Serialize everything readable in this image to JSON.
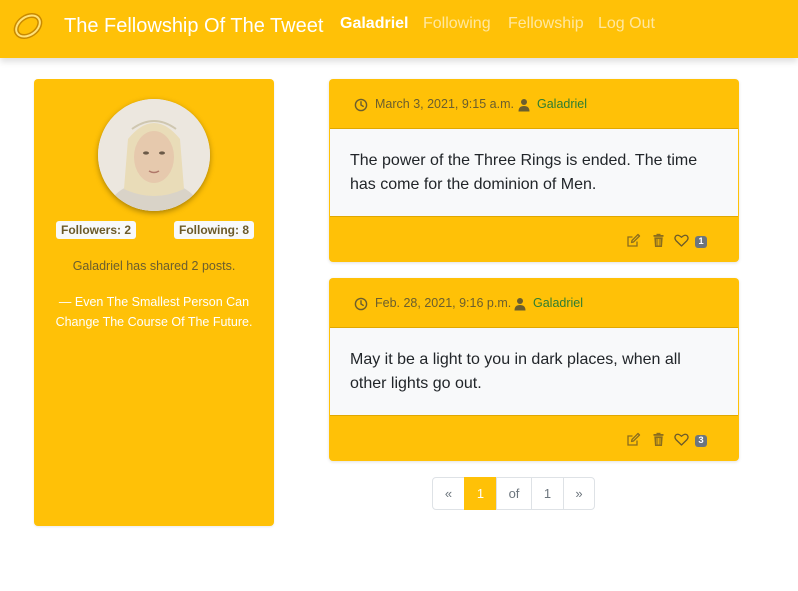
{
  "navbar": {
    "brand_title": "The Fellowship Of The Tweet",
    "links": [
      {
        "label": "Galadriel",
        "active": true
      },
      {
        "label": "Following",
        "active": false
      },
      {
        "label": "Fellowship",
        "active": false
      },
      {
        "label": "Log Out",
        "active": false
      }
    ]
  },
  "profile": {
    "followers_label": "Followers: 2",
    "following_label": "Following: 8",
    "shared_text": "Galadriel has shared 2 posts.",
    "quote": "— Even The Smallest Person Can Change The Course Of The Future."
  },
  "posts": [
    {
      "date": "March 3, 2021, 9:15 a.m.",
      "author": "Galadriel",
      "text": "The power of the Three Rings is ended. The time has come for the dominion of Men.",
      "likes": "1"
    },
    {
      "date": "Feb. 28, 2021, 9:16 p.m.",
      "author": "Galadriel",
      "text": "May it be a light to you in dark places, when all other lights go out.",
      "likes": "3"
    }
  ],
  "pagination": {
    "prev": "«",
    "current": "1",
    "of": "of",
    "total": "1",
    "next": "»"
  },
  "colors": {
    "primary": "#ffc107",
    "body_bg": "#f8f9fa",
    "author_link": "#2e7d32",
    "badge_secondary": "#6c757d"
  },
  "icons": {
    "brand": "ring-icon",
    "date": "clock-icon",
    "author": "user-icon",
    "edit": "edit-icon",
    "delete": "trash-icon",
    "like": "heart-icon"
  }
}
